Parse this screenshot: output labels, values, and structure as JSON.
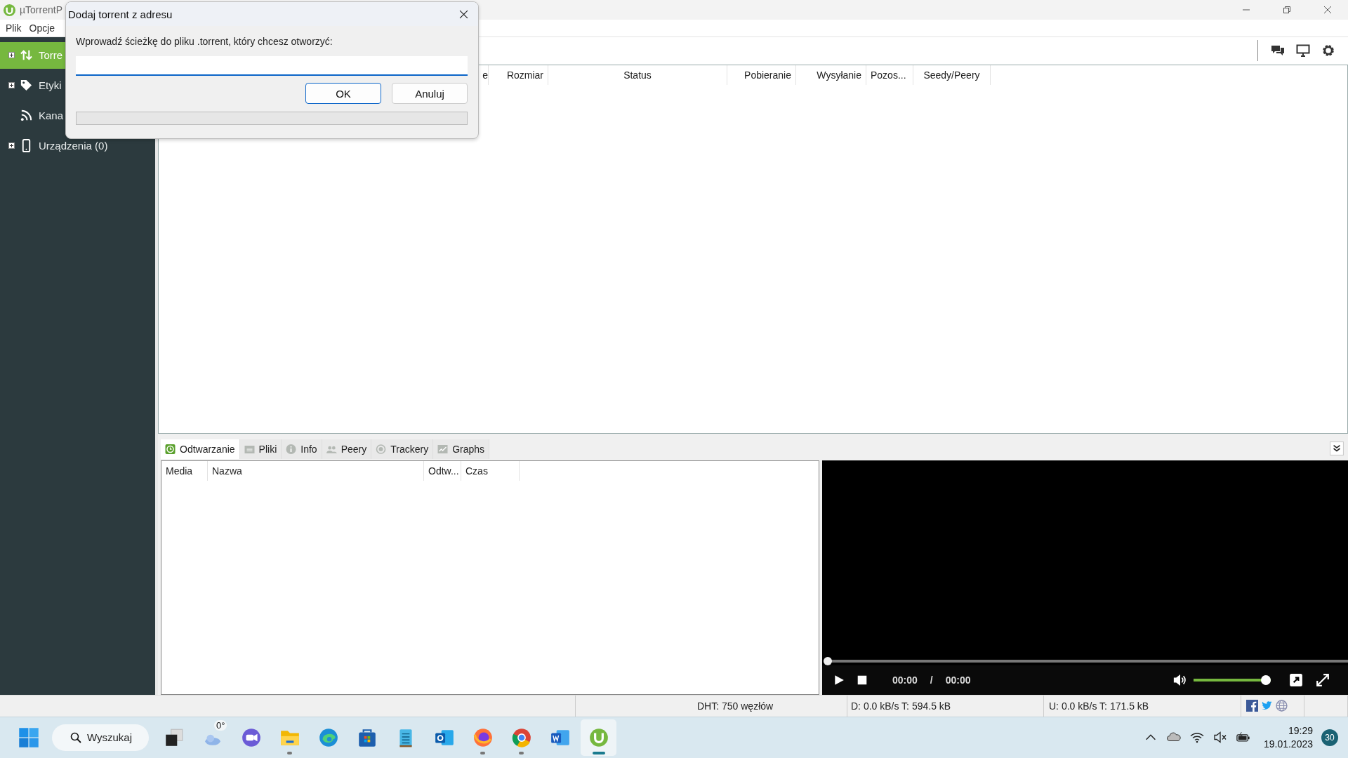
{
  "window": {
    "title": "µTorrentP"
  },
  "menu": [
    "Plik",
    "Opcje"
  ],
  "sidebar": {
    "items": [
      {
        "label": "Torre",
        "kind": "torrents",
        "expandable": true,
        "selected": true
      },
      {
        "label": "Etyki",
        "kind": "labels",
        "expandable": true,
        "selected": false
      },
      {
        "label": "Kana",
        "kind": "feeds",
        "expandable": false,
        "selected": false
      },
      {
        "label": "Urządzenia (0)",
        "kind": "devices",
        "expandable": true,
        "selected": false
      }
    ]
  },
  "torrent_list": {
    "columns": [
      "e",
      "Rozmiar",
      "Status",
      "Pobieranie",
      "Wysyłanie",
      "Pozos...",
      "Seedy/Peery"
    ]
  },
  "detail_tabs": [
    {
      "label": "Odtwarzanie",
      "kind": "play",
      "selected": true
    },
    {
      "label": "Pliki",
      "kind": "files",
      "selected": false
    },
    {
      "label": "Info",
      "kind": "info",
      "selected": false
    },
    {
      "label": "Peery",
      "kind": "peers",
      "selected": false
    },
    {
      "label": "Trackery",
      "kind": "trackers",
      "selected": false
    },
    {
      "label": "Graphs",
      "kind": "graphs",
      "selected": false
    }
  ],
  "playlist": {
    "columns": [
      "Media",
      "Nazwa",
      "Odtw...",
      "Czas"
    ]
  },
  "player": {
    "position": {
      "level": 0
    },
    "elapsed": "00:00",
    "separator": "/",
    "duration": "00:00",
    "volume": {
      "level": 1
    }
  },
  "status_bar": [
    "DHT: 750 węzłów",
    "D: 0.0 kB/s T: 594.5 kB",
    "U: 0.0 kB/s T: 171.5 kB"
  ],
  "dialog": {
    "title": "Dodaj torrent z adresu",
    "prompt": "Wprowadź ścieżkę do pliku .torrent, który chcesz otworzyć:",
    "input": {
      "focused": true
    },
    "buttons": [
      {
        "label": "OK",
        "default": true
      },
      {
        "label": "Anuluj",
        "default": false
      }
    ],
    "progress": {
      "level": 0
    }
  },
  "taskbar": {
    "search": "Wyszukaj",
    "weather": "0°",
    "apps": [
      {
        "kind": "taskview",
        "running": false,
        "active": false
      },
      {
        "kind": "weather",
        "running": false,
        "active": false
      },
      {
        "kind": "chat",
        "running": false,
        "active": false
      },
      {
        "kind": "folder",
        "running": true,
        "active": false
      },
      {
        "kind": "edge",
        "running": false,
        "active": false
      },
      {
        "kind": "store",
        "running": false,
        "active": false
      },
      {
        "kind": "notepad",
        "running": false,
        "active": false
      },
      {
        "kind": "outlook",
        "running": false,
        "active": false
      },
      {
        "kind": "firefox",
        "running": true,
        "active": false
      },
      {
        "kind": "chrome",
        "running": true,
        "active": false
      },
      {
        "kind": "word",
        "running": false,
        "active": false
      },
      {
        "kind": "utorrent",
        "running": true,
        "active": true
      }
    ],
    "clock": {
      "time": "19:29",
      "date": "19.01.2023"
    },
    "notifications": "30"
  }
}
